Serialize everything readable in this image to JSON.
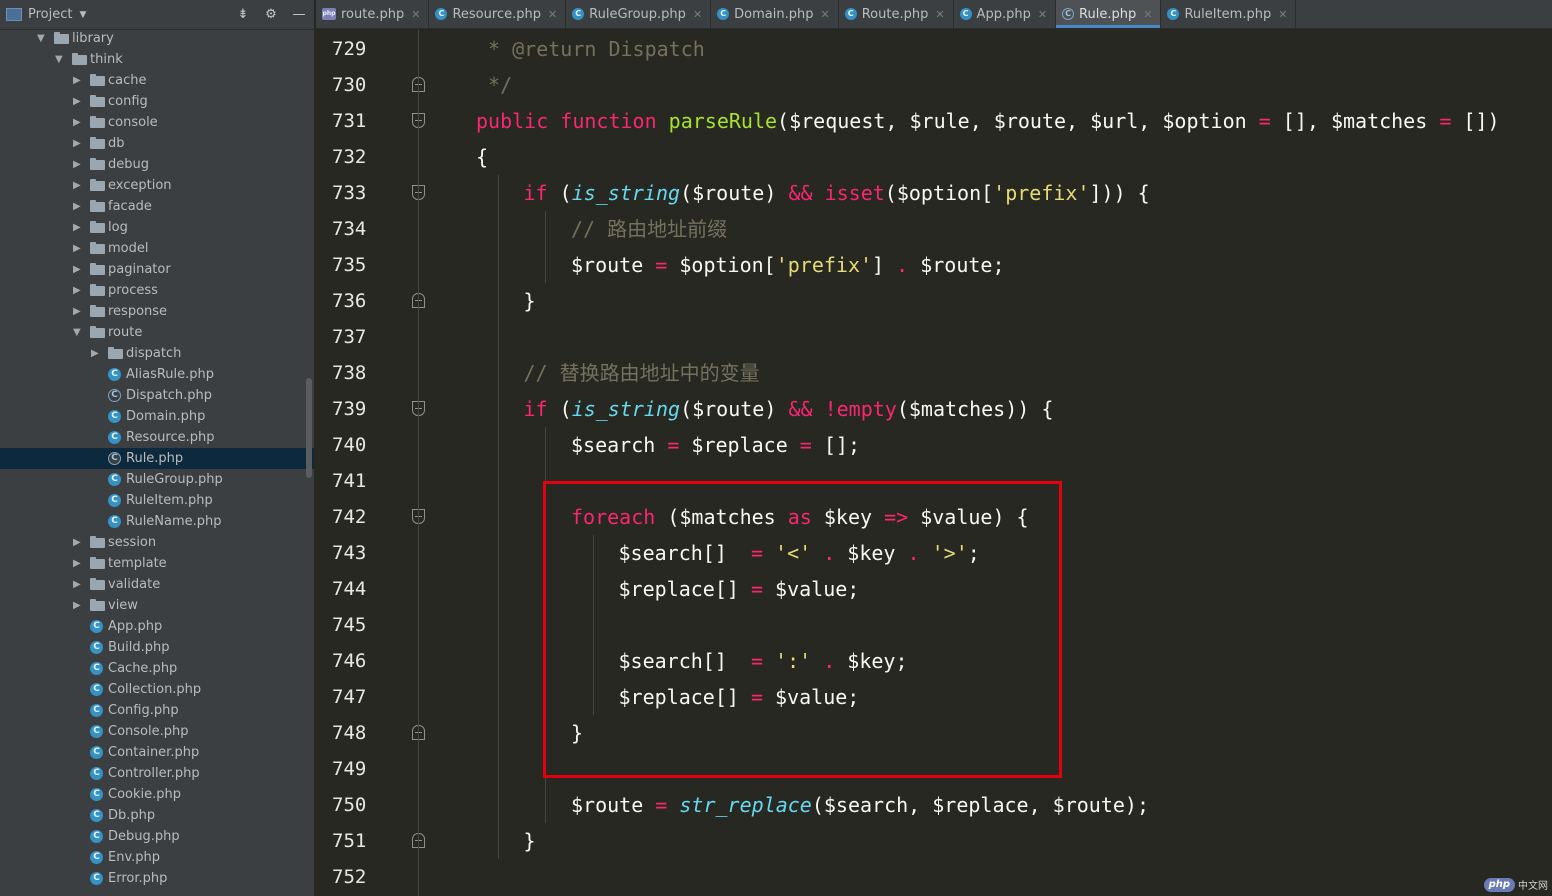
{
  "project_panel": {
    "title": "Project",
    "tree": [
      {
        "label": "library",
        "type": "folder",
        "level": 0,
        "expanded": true
      },
      {
        "label": "think",
        "type": "folder",
        "level": 1,
        "expanded": true
      },
      {
        "label": "cache",
        "type": "folder",
        "level": 2,
        "expanded": false
      },
      {
        "label": "config",
        "type": "folder",
        "level": 2,
        "expanded": false
      },
      {
        "label": "console",
        "type": "folder",
        "level": 2,
        "expanded": false
      },
      {
        "label": "db",
        "type": "folder",
        "level": 2,
        "expanded": false
      },
      {
        "label": "debug",
        "type": "folder",
        "level": 2,
        "expanded": false
      },
      {
        "label": "exception",
        "type": "folder",
        "level": 2,
        "expanded": false
      },
      {
        "label": "facade",
        "type": "folder",
        "level": 2,
        "expanded": false
      },
      {
        "label": "log",
        "type": "folder",
        "level": 2,
        "expanded": false
      },
      {
        "label": "model",
        "type": "folder",
        "level": 2,
        "expanded": false
      },
      {
        "label": "paginator",
        "type": "folder",
        "level": 2,
        "expanded": false
      },
      {
        "label": "process",
        "type": "folder",
        "level": 2,
        "expanded": false
      },
      {
        "label": "response",
        "type": "folder",
        "level": 2,
        "expanded": false
      },
      {
        "label": "route",
        "type": "folder",
        "level": 2,
        "expanded": true
      },
      {
        "label": "dispatch",
        "type": "folder",
        "level": 3,
        "expanded": false
      },
      {
        "label": "AliasRule.php",
        "type": "class",
        "level": 3
      },
      {
        "label": "Dispatch.php",
        "type": "abstract",
        "level": 3
      },
      {
        "label": "Domain.php",
        "type": "class",
        "level": 3
      },
      {
        "label": "Resource.php",
        "type": "class",
        "level": 3
      },
      {
        "label": "Rule.php",
        "type": "abstract",
        "level": 3,
        "selected": true
      },
      {
        "label": "RuleGroup.php",
        "type": "class",
        "level": 3
      },
      {
        "label": "RuleItem.php",
        "type": "class",
        "level": 3
      },
      {
        "label": "RuleName.php",
        "type": "class",
        "level": 3
      },
      {
        "label": "session",
        "type": "folder",
        "level": 2,
        "expanded": false
      },
      {
        "label": "template",
        "type": "folder",
        "level": 2,
        "expanded": false
      },
      {
        "label": "validate",
        "type": "folder",
        "level": 2,
        "expanded": false
      },
      {
        "label": "view",
        "type": "folder",
        "level": 2,
        "expanded": false
      },
      {
        "label": "App.php",
        "type": "class",
        "level": 2
      },
      {
        "label": "Build.php",
        "type": "class",
        "level": 2
      },
      {
        "label": "Cache.php",
        "type": "class",
        "level": 2
      },
      {
        "label": "Collection.php",
        "type": "class",
        "level": 2
      },
      {
        "label": "Config.php",
        "type": "class",
        "level": 2
      },
      {
        "label": "Console.php",
        "type": "class",
        "level": 2
      },
      {
        "label": "Container.php",
        "type": "class",
        "level": 2
      },
      {
        "label": "Controller.php",
        "type": "class",
        "level": 2
      },
      {
        "label": "Cookie.php",
        "type": "class",
        "level": 2
      },
      {
        "label": "Db.php",
        "type": "class",
        "level": 2
      },
      {
        "label": "Debug.php",
        "type": "class",
        "level": 2
      },
      {
        "label": "Env.php",
        "type": "class",
        "level": 2
      },
      {
        "label": "Error.php",
        "type": "class",
        "level": 2
      }
    ]
  },
  "tabs": [
    {
      "label": "route.php",
      "icon": "php-file-icon",
      "active": false
    },
    {
      "label": "Resource.php",
      "icon": "class-icon",
      "active": false
    },
    {
      "label": "RuleGroup.php",
      "icon": "class-icon",
      "active": false
    },
    {
      "label": "Domain.php",
      "icon": "class-icon",
      "active": false
    },
    {
      "label": "Route.php",
      "icon": "class-icon",
      "active": false
    },
    {
      "label": "App.php",
      "icon": "class-icon",
      "active": false
    },
    {
      "label": "Rule.php",
      "icon": "abstract-class-icon",
      "active": true
    },
    {
      "label": "RuleItem.php",
      "icon": "class-icon",
      "active": false
    }
  ],
  "editor": {
    "lines": [
      {
        "num": "729",
        "indent": 1,
        "tokens": [
          [
            "c",
            " * @return Dispatch"
          ]
        ]
      },
      {
        "num": "730",
        "indent": 1,
        "tokens": [
          [
            "c",
            " */"
          ]
        ]
      },
      {
        "num": "731",
        "indent": 1,
        "tokens": [
          [
            "k",
            "public"
          ],
          [
            "",
            " "
          ],
          [
            "k",
            "function"
          ],
          [
            "",
            " "
          ],
          [
            "f",
            "parseRule"
          ],
          [
            "",
            "($request, $rule, $route, $url, $option "
          ],
          [
            "o",
            "="
          ],
          [
            "",
            " [], $matches "
          ],
          [
            "o",
            "="
          ],
          [
            "",
            " [])"
          ]
        ]
      },
      {
        "num": "732",
        "indent": 1,
        "tokens": [
          [
            "",
            "{"
          ]
        ]
      },
      {
        "num": "733",
        "indent": 2,
        "tokens": [
          [
            "k",
            "if"
          ],
          [
            "",
            " ("
          ],
          [
            "b",
            "is_string"
          ],
          [
            "",
            "($route) "
          ],
          [
            "o",
            "&&"
          ],
          [
            "",
            " "
          ],
          [
            "k",
            "isset"
          ],
          [
            "",
            "($option["
          ],
          [
            "s",
            "'prefix'"
          ],
          [
            "",
            "])) {"
          ]
        ]
      },
      {
        "num": "734",
        "indent": 3,
        "tokens": [
          [
            "c",
            "// 路由地址前缀"
          ]
        ]
      },
      {
        "num": "735",
        "indent": 3,
        "tokens": [
          [
            "",
            "$route "
          ],
          [
            "o",
            "="
          ],
          [
            "",
            " $option["
          ],
          [
            "s",
            "'prefix'"
          ],
          [
            "",
            "] "
          ],
          [
            "o",
            "."
          ],
          [
            "",
            " $route;"
          ]
        ]
      },
      {
        "num": "736",
        "indent": 2,
        "tokens": [
          [
            "",
            "}"
          ]
        ]
      },
      {
        "num": "737",
        "indent": 0,
        "tokens": []
      },
      {
        "num": "738",
        "indent": 2,
        "tokens": [
          [
            "c",
            "// 替换路由地址中的变量"
          ]
        ]
      },
      {
        "num": "739",
        "indent": 2,
        "tokens": [
          [
            "k",
            "if"
          ],
          [
            "",
            " ("
          ],
          [
            "b",
            "is_string"
          ],
          [
            "",
            "($route) "
          ],
          [
            "o",
            "&&"
          ],
          [
            "",
            " "
          ],
          [
            "o",
            "!"
          ],
          [
            "k",
            "empty"
          ],
          [
            "",
            "($matches)) {"
          ]
        ]
      },
      {
        "num": "740",
        "indent": 3,
        "tokens": [
          [
            "",
            "$search "
          ],
          [
            "o",
            "="
          ],
          [
            "",
            " $replace "
          ],
          [
            "o",
            "="
          ],
          [
            "",
            " [];"
          ]
        ]
      },
      {
        "num": "741",
        "indent": 0,
        "tokens": []
      },
      {
        "num": "742",
        "indent": 3,
        "tokens": [
          [
            "k",
            "foreach"
          ],
          [
            "",
            " ($matches "
          ],
          [
            "k",
            "as"
          ],
          [
            "",
            " $key "
          ],
          [
            "o",
            "=>"
          ],
          [
            "",
            " $value) {"
          ]
        ]
      },
      {
        "num": "743",
        "indent": 4,
        "tokens": [
          [
            "",
            "$search[]  "
          ],
          [
            "o",
            "="
          ],
          [
            "",
            " "
          ],
          [
            "s",
            "'<'"
          ],
          [
            "",
            " "
          ],
          [
            "o",
            "."
          ],
          [
            "",
            " $key "
          ],
          [
            "o",
            "."
          ],
          [
            "",
            " "
          ],
          [
            "s",
            "'>'"
          ],
          [
            "",
            ";"
          ]
        ]
      },
      {
        "num": "744",
        "indent": 4,
        "tokens": [
          [
            "",
            "$replace[] "
          ],
          [
            "o",
            "="
          ],
          [
            "",
            " $value;"
          ]
        ]
      },
      {
        "num": "745",
        "indent": 0,
        "tokens": []
      },
      {
        "num": "746",
        "indent": 4,
        "tokens": [
          [
            "",
            "$search[]  "
          ],
          [
            "o",
            "="
          ],
          [
            "",
            " "
          ],
          [
            "s",
            "':'"
          ],
          [
            "",
            " "
          ],
          [
            "o",
            "."
          ],
          [
            "",
            " $key;"
          ]
        ]
      },
      {
        "num": "747",
        "indent": 4,
        "tokens": [
          [
            "",
            "$replace[] "
          ],
          [
            "o",
            "="
          ],
          [
            "",
            " $value;"
          ]
        ]
      },
      {
        "num": "748",
        "indent": 3,
        "tokens": [
          [
            "",
            "}"
          ]
        ]
      },
      {
        "num": "749",
        "indent": 0,
        "tokens": []
      },
      {
        "num": "750",
        "indent": 3,
        "tokens": [
          [
            "",
            "$route "
          ],
          [
            "o",
            "="
          ],
          [
            "",
            " "
          ],
          [
            "b",
            "str_replace"
          ],
          [
            "",
            "($search, $replace, $route);"
          ]
        ]
      },
      {
        "num": "751",
        "indent": 2,
        "tokens": [
          [
            "",
            "}"
          ]
        ]
      },
      {
        "num": "752",
        "indent": 0,
        "tokens": []
      }
    ],
    "fold_markers": [
      {
        "line": "730",
        "kind": "close"
      },
      {
        "line": "731",
        "kind": "open"
      },
      {
        "line": "733",
        "kind": "open"
      },
      {
        "line": "736",
        "kind": "close"
      },
      {
        "line": "739",
        "kind": "open"
      },
      {
        "line": "742",
        "kind": "open"
      },
      {
        "line": "748",
        "kind": "close"
      },
      {
        "line": "751",
        "kind": "close"
      }
    ]
  },
  "watermark": {
    "logo": "php",
    "text": "中文网"
  },
  "colors": {
    "highlight_box": "#e3000f",
    "keyword": "#f92672",
    "function": "#a6e22e",
    "builtin": "#66d9ef",
    "string": "#e6db74",
    "comment": "#75715e"
  }
}
